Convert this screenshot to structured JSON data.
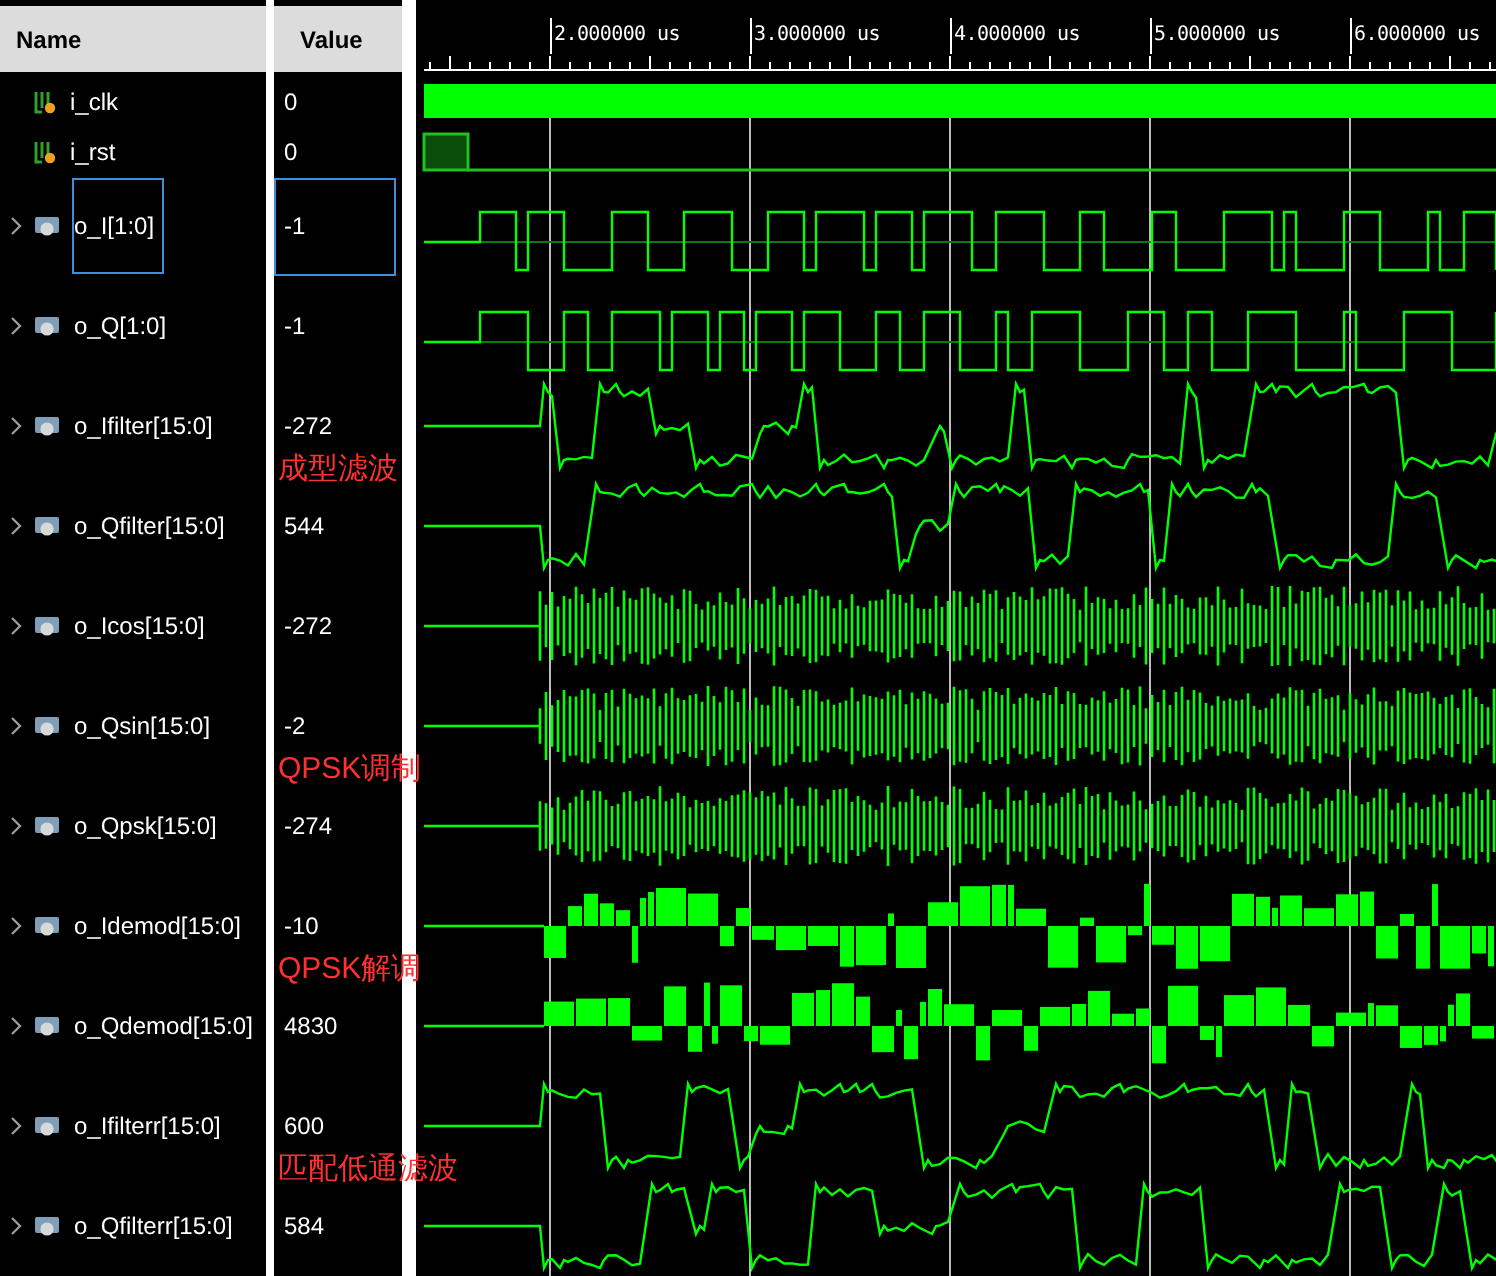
{
  "columns": {
    "name": "Name",
    "value": "Value"
  },
  "ruler": {
    "labels": [
      "2.000000 us",
      "3.000000 us",
      "4.000000 us",
      "5.000000 us",
      "6.000000 us"
    ]
  },
  "signals": [
    {
      "name": "i_clk",
      "value": "0",
      "expandable": false,
      "kind": "clock",
      "selected": false
    },
    {
      "name": "i_rst",
      "value": "0",
      "expandable": false,
      "kind": "step",
      "selected": false
    },
    {
      "name": "o_I[1:0]",
      "value": "-1",
      "expandable": true,
      "kind": "digital",
      "selected": true
    },
    {
      "name": "o_Q[1:0]",
      "value": "-1",
      "expandable": true,
      "kind": "digital",
      "selected": false
    },
    {
      "name": "o_Ifilter[15:0]",
      "value": "-272",
      "expandable": true,
      "kind": "analog",
      "selected": false,
      "note": "成型滤波"
    },
    {
      "name": "o_Qfilter[15:0]",
      "value": "544",
      "expandable": true,
      "kind": "analog",
      "selected": false
    },
    {
      "name": "o_Icos[15:0]",
      "value": "-272",
      "expandable": true,
      "kind": "dense",
      "selected": false
    },
    {
      "name": "o_Qsin[15:0]",
      "value": "-2",
      "expandable": true,
      "kind": "dense",
      "selected": false,
      "note": "QPSK调制"
    },
    {
      "name": "o_Qpsk[15:0]",
      "value": "-274",
      "expandable": true,
      "kind": "dense",
      "selected": false
    },
    {
      "name": "o_Idemod[15:0]",
      "value": "-10",
      "expandable": true,
      "kind": "block",
      "selected": false,
      "note": "QPSK解调"
    },
    {
      "name": "o_Qdemod[15:0]",
      "value": "4830",
      "expandable": true,
      "kind": "block",
      "selected": false
    },
    {
      "name": "o_Ifilterr[15:0]",
      "value": "600",
      "expandable": true,
      "kind": "analog",
      "selected": false,
      "note": "匹配低通滤波"
    },
    {
      "name": "o_Qfilterr[15:0]",
      "value": "584",
      "expandable": true,
      "kind": "analog",
      "selected": false
    }
  ]
}
